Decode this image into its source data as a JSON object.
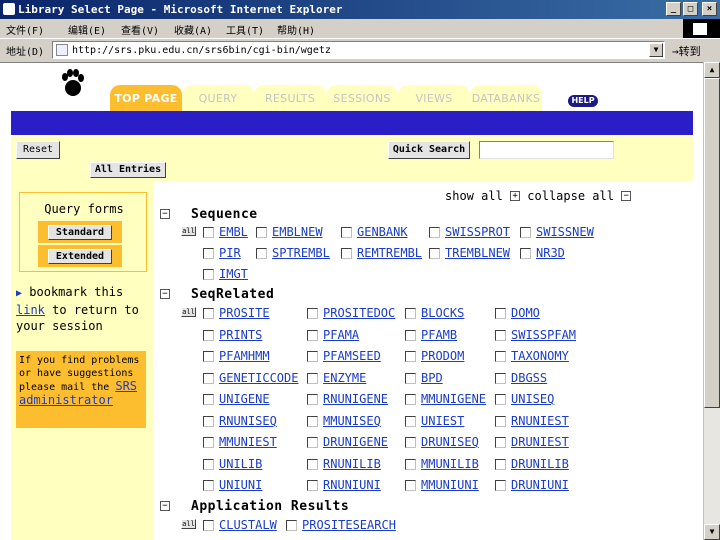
{
  "window": {
    "title": "Library Select Page - Microsoft Internet Explorer",
    "btn_min": "_",
    "btn_max": "□",
    "btn_close": "×"
  },
  "menu": [
    "文件(F)",
    "编辑(E)",
    "查看(V)",
    "收藏(A)",
    "工具(T)",
    "帮助(H)"
  ],
  "address": {
    "label": "地址(D)",
    "url": "http://srs.pku.edu.cn/srs6bin/cgi-bin/wgetz",
    "go": "转到"
  },
  "tabs": [
    "TOP PAGE",
    "QUERY",
    "RESULTS",
    "SESSIONS",
    "VIEWS",
    "DATABANKS"
  ],
  "active_tab": "TOP PAGE",
  "help_label": "HELP",
  "toolbar": {
    "reset": "Reset",
    "all_entries": "All Entries",
    "quick_search": "Quick Search",
    "quick_search_value": ""
  },
  "sidebar": {
    "query_forms_title": "Query forms",
    "standard": "Standard",
    "extended": "Extended",
    "bookmark_pre": "bookmark this",
    "bookmark_link": "link",
    "bookmark_post": "to return to your session",
    "help_text": "If you find problems or have suggestions please mail the",
    "admin_link": "SRS administrator"
  },
  "controls": {
    "show_all": "show all",
    "collapse_all": "collapse all",
    "plus": "+",
    "minus": "−"
  },
  "all_label": "all",
  "sections": [
    {
      "title": "Sequence",
      "rows": [
        [
          "EMBL",
          "EMBLNEW",
          "GENBANK",
          "SWISSPROT",
          "SWISSNEW"
        ],
        [
          "PIR",
          "SPTREMBL",
          "REMTREMBL",
          "TREMBLNEW",
          "NR3D"
        ],
        [
          "IMGT"
        ]
      ]
    },
    {
      "title": "SeqRelated",
      "rows": [
        [
          "PROSITE",
          "PROSITEDOC",
          "BLOCKS",
          "DOMO"
        ],
        [
          "PRINTS",
          "PFAMA",
          "PFAMB",
          "SWISSPFAM"
        ],
        [
          "PFAMHMM",
          "PFAMSEED",
          "PRODOM",
          "TAXONOMY"
        ],
        [
          "GENETICCODE",
          "ENZYME",
          "BPD",
          "DBGSS"
        ],
        [
          "UNIGENE",
          "RNUNIGENE",
          "MMUNIGENE",
          "UNISEQ"
        ],
        [
          "RNUNISEQ",
          "MMUNISEQ",
          "UNIEST",
          "RNUNIEST"
        ],
        [
          "MMUNIEST",
          "DRUNIGENE",
          "DRUNISEQ",
          "DRUNIEST"
        ],
        [
          "UNILIB",
          "RNUNILIB",
          "MMUNILIB",
          "DRUNILIB"
        ],
        [
          "UNIUNI",
          "RNUNIUNI",
          "MMUNIUNI",
          "DRUNIUNI"
        ]
      ]
    },
    {
      "title": "Application Results",
      "rows": [
        [
          "CLUSTALW",
          "PROSITESEARCH"
        ]
      ]
    }
  ]
}
